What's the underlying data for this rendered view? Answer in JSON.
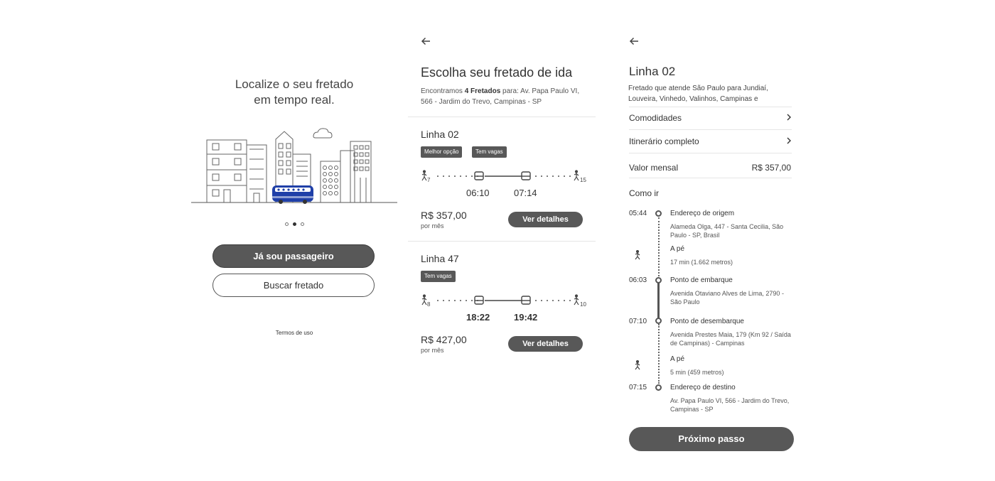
{
  "onboarding": {
    "title_line1": "Localize o seu fretado",
    "title_line2": "em tempo real.",
    "illustration": "city-with-bus-illustration",
    "carousel": {
      "pages": 3,
      "active": 2
    },
    "primary_button": "Já sou passageiro",
    "secondary_button": "Buscar fretado",
    "terms_link": "Termos de uso"
  },
  "search_results": {
    "back_icon": "arrow-left-icon",
    "title": "Escolha seu fretado de ida",
    "summary_prefix": "Encontramos ",
    "summary_count": "4 Fretados",
    "summary_suffix": " para: Av. Papa Paulo VI, 566 - Jardim do Trevo, Campinas - SP",
    "results": [
      {
        "name": "Linha 02",
        "tags": [
          "Melhor opção",
          "Tem vagas"
        ],
        "walk_start_min": "7",
        "departure": "06:10",
        "arrival": "07:14",
        "walk_end_min": "15",
        "price": "R$ 357,00",
        "price_period": "por mês",
        "button": "Ver detalhes"
      },
      {
        "name": "Linha 47",
        "tags": [
          "Tem vagas"
        ],
        "walk_start_min": "8",
        "departure": "18:22",
        "arrival": "19:42",
        "walk_end_min": "10",
        "price": "R$ 427,00",
        "price_period": "por mês",
        "button": "Ver detalhes"
      }
    ]
  },
  "line_detail": {
    "back_icon": "arrow-left-icon",
    "title": "Linha 02",
    "description": "Fretado que atende São Paulo para Jundiaí, Louveira, Vinhedo, Valinhos, Campinas e",
    "menu": [
      {
        "label": "Comodidades"
      },
      {
        "label": "Itinerário completo"
      }
    ],
    "monthly_label": "Valor mensal",
    "monthly_value": "R$ 357,00",
    "how_to_go": "Como ir",
    "steps": [
      {
        "time": "05:44",
        "title": "Endereço de origem",
        "desc": "Alameda Olga, 447 - Santa Cecilia, São Paulo - SP, Brasil"
      },
      {
        "time": "",
        "title": "A pé",
        "desc": "17 min (1.662 metros)"
      },
      {
        "time": "06:03",
        "title": "Ponto de embarque",
        "desc": "Avenida Otaviano Alves de Lima, 2790 - São Paulo"
      },
      {
        "time": "07:10",
        "title": "Ponto de desembarque",
        "desc": "Avenida Prestes Maia, 179 (Km 92 / Saída de Campinas) - Campinas"
      },
      {
        "time": "",
        "title": "A pé",
        "desc": "5 min (459 metros)"
      },
      {
        "time": "07:15",
        "title": "Endereço de destino",
        "desc": "Av. Papa Paulo VI, 566 - Jardim do Trevo, Campinas - SP"
      }
    ],
    "next_button": "Próximo passo"
  },
  "colors": {
    "button_dark": "#585858",
    "bus_blue": "#1f3fa8",
    "text": "#333333",
    "divider": "#e6e6e6"
  }
}
